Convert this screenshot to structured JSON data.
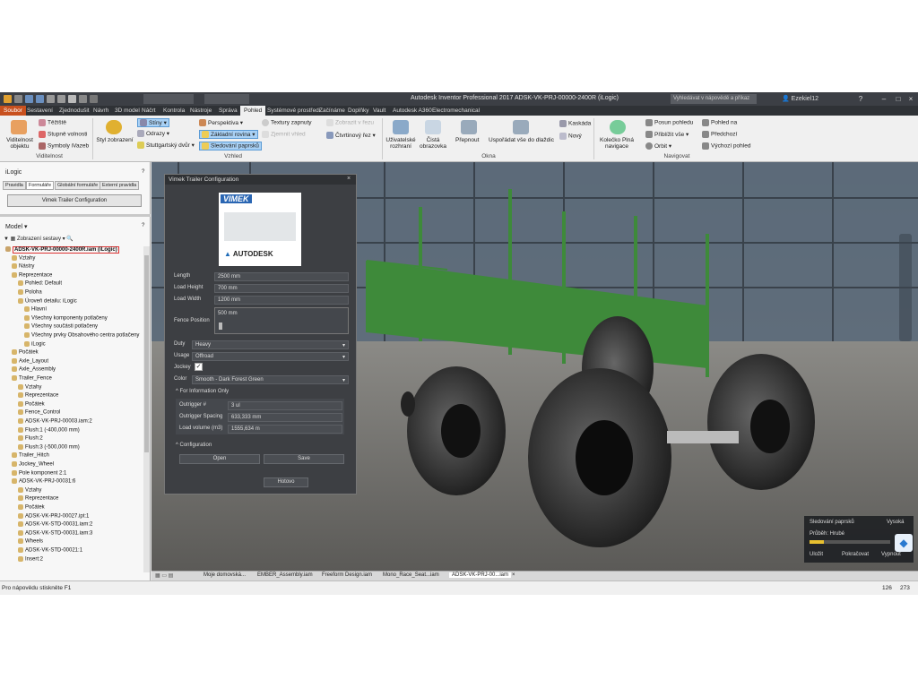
{
  "window": {
    "title": "Autodesk Inventor Professional 2017   ADSK-VK-PRJ-00000-2400R (iLogic)",
    "search_placeholder": "Vyhledávat v nápovědě a příkaz",
    "user": "Ezekiel12"
  },
  "tabs": [
    "Soubor",
    "Sestavení",
    "Zjednodušit",
    "Návrh",
    "3D model",
    "Náčrt",
    "Kontrola",
    "Nástroje",
    "Správa",
    "Pohled",
    "Systémové prostředí",
    "Začínáme",
    "Doplňky",
    "Vault",
    "Autodesk A360",
    "Electromechanical"
  ],
  "active_tab": "Pohled",
  "ribbon": {
    "visibility": {
      "big": "Viditelnost objektu",
      "items": [
        "Těžiště",
        "Stupně volnosti",
        "Symboly iVazeb"
      ],
      "group": "Viditelnost"
    },
    "appearance": {
      "style": "Styl zobrazení",
      "items": [
        "Stíny",
        "Odrazy",
        "Stuttgartský dvůr",
        "Perspektiva",
        "Základní rovina",
        "Sledování paprsků",
        "Textury zapnuty",
        "Zjemnit vhled",
        "Zobrazit v řezu",
        "Čtvrtinový řez"
      ],
      "group": "Vzhled"
    },
    "window": {
      "items": [
        "Uživatelské rozhraní",
        "Čistá obrazovka",
        "Přepnout",
        "Uspořádat vše do dlaždic",
        "Kaskáda",
        "Nový"
      ],
      "group": "Okna"
    },
    "navigate": {
      "items": [
        "Kolečko Plná navigace",
        "Posun pohledu",
        "Přiblížit vše",
        "Orbit",
        "Pohled na",
        "Předchozí",
        "Výchozí pohled"
      ],
      "group": "Navigovat"
    }
  },
  "ilogic": {
    "title": "iLogic",
    "tabs": [
      "Pravidla",
      "Formuláře",
      "Globální formuláře",
      "Externí pravidla"
    ],
    "button": "Vimek Trailer Configuration"
  },
  "browser": {
    "title": "Model",
    "view": "Zobrazení sestavy",
    "items": [
      {
        "t": "ADSK-VK-PRJ-00000-2400R.iam (iLogic)",
        "d": 0,
        "s": 1
      },
      {
        "t": "Vztahy",
        "d": 1
      },
      {
        "t": "Nástry",
        "d": 1
      },
      {
        "t": "Reprezentace",
        "d": 1
      },
      {
        "t": "Pohled: Default",
        "d": 2
      },
      {
        "t": "Poloha",
        "d": 2
      },
      {
        "t": "Úroveň detailu: iLogic",
        "d": 2
      },
      {
        "t": "Hlavní",
        "d": 3
      },
      {
        "t": "Všechny komponenty potlačeny",
        "d": 3
      },
      {
        "t": "Všechny součásti potlačeny",
        "d": 3
      },
      {
        "t": "Všechny prvky Obsahového centra potlačeny",
        "d": 3
      },
      {
        "t": "iLogic",
        "d": 3
      },
      {
        "t": "Počátek",
        "d": 1
      },
      {
        "t": "Axle_Layout",
        "d": 1
      },
      {
        "t": "Axle_Assembly",
        "d": 1
      },
      {
        "t": "Trailer_Fence",
        "d": 1
      },
      {
        "t": "Vztahy",
        "d": 2
      },
      {
        "t": "Reprezentace",
        "d": 2
      },
      {
        "t": "Počátek",
        "d": 2
      },
      {
        "t": "Fence_Control",
        "d": 2
      },
      {
        "t": "ADSK-VK-PRJ-00003.iam:2",
        "d": 2
      },
      {
        "t": "Flush:1 (-400,000 mm)",
        "d": 2
      },
      {
        "t": "Flush:2",
        "d": 2
      },
      {
        "t": "Flush:3 (-500,000 mm)",
        "d": 2
      },
      {
        "t": "Trailer_Hitch",
        "d": 1
      },
      {
        "t": "Jockey_Wheel",
        "d": 1
      },
      {
        "t": "Pole komponent 2:1",
        "d": 1
      },
      {
        "t": "ADSK-VK-PRJ-00031:6",
        "d": 1
      },
      {
        "t": "Vztahy",
        "d": 2
      },
      {
        "t": "Reprezentace",
        "d": 2
      },
      {
        "t": "Počátek",
        "d": 2
      },
      {
        "t": "ADSK-VK-PRJ-00027.ipt:1",
        "d": 2
      },
      {
        "t": "ADSK-VK-STD-00031.iam:2",
        "d": 2
      },
      {
        "t": "ADSK-VK-STD-00031.iam:3",
        "d": 2
      },
      {
        "t": "Wheels",
        "d": 2
      },
      {
        "t": "ADSK-VK-STD-00021:1",
        "d": 2
      },
      {
        "t": "Insert:2",
        "d": 2
      }
    ]
  },
  "dialog": {
    "title": "Vimek Trailer Configuration",
    "logo_brand": "VIMEK",
    "logo_autodesk": "AUTODESK",
    "fields": [
      {
        "label": "Length",
        "value": "2500 mm"
      },
      {
        "label": "Load Height",
        "value": "700 mm"
      },
      {
        "label": "Load Width",
        "value": "1200 mm"
      }
    ],
    "fence": {
      "label": "Fence Position",
      "value": "500 mm"
    },
    "duty": {
      "label": "Duty",
      "value": "Heavy"
    },
    "usage": {
      "label": "Usage",
      "value": "Offroad"
    },
    "jockey": {
      "label": "Jockey"
    },
    "color": {
      "label": "Color",
      "value": "Smooth - Dark Forest Green"
    },
    "info_title": "For Information Only",
    "info": [
      {
        "label": "Outrigger #",
        "value": "3 ul"
      },
      {
        "label": "Outrigger Spacing",
        "value": "633,333 mm"
      },
      {
        "label": "Load volume (m3)",
        "value": "1555,634 m"
      }
    ],
    "config_title": "Configuration",
    "open": "Open",
    "save": "Save",
    "done": "Hotovo"
  },
  "raytrace": {
    "title": "Sledování paprsků",
    "quality": "Vysoká",
    "progress": "Průběh: Hrubé",
    "progress_value": 0.18,
    "stop": "Uložit",
    "resume": "Pokračovat",
    "exit": "Vypnout"
  },
  "doc_tabs": [
    "Moje domovská...",
    "EMBER_Assembly.iam",
    "Freeform Design.iam",
    "Mono_Race_Seat...iam",
    "ADSK-VK-PRJ-00...iam"
  ],
  "status": {
    "help": "Pro nápovědu stiskněte F1",
    "n1": "126",
    "n2": "273"
  },
  "colors": {
    "accent": "#c8501e",
    "trailer_green": "#3e8a3a",
    "highlight": "#a9d1f5"
  }
}
